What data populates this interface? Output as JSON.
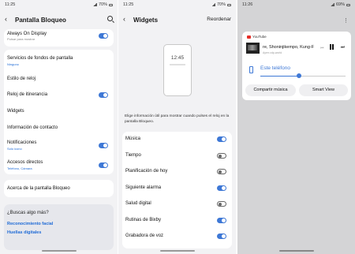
{
  "panel1": {
    "status": {
      "time": "11:25",
      "battery": "70%"
    },
    "title": "Pantalla Bloqueo",
    "items": [
      {
        "label": "Always On Display",
        "sub": "Pulsar para mostrar",
        "toggle": true
      },
      {
        "label": "Servicios de fondos de pantalla",
        "sub": "Ninguno"
      },
      {
        "label": "Estilo de reloj"
      },
      {
        "label": "Reloj de itinerancia",
        "toggle": true
      },
      {
        "label": "Widgets"
      },
      {
        "label": "Información de contacto"
      },
      {
        "label": "Notificaciones",
        "sub": "Solo icono",
        "toggle": true
      },
      {
        "label": "Accesos directos",
        "sub": "Teléfono, Cámara",
        "toggle": true
      },
      {
        "label": "Acerca de la pantalla Bloqueo"
      }
    ],
    "suggest": {
      "title": "¿Buscas algo más?",
      "links": [
        "Reconocimiento facial",
        "Huellas digitales"
      ]
    }
  },
  "panel2": {
    "status": {
      "time": "11:25",
      "battery": "70%"
    },
    "title": "Widgets",
    "action": "Reordenar",
    "preview_clock": "12:45",
    "description": "Elige información útil para mostrar cuando pulses el reloj en la pantalla Bloqueo.",
    "items": [
      {
        "label": "Música",
        "on": true
      },
      {
        "label": "Tiempo",
        "on": false
      },
      {
        "label": "Planificación de hoy",
        "on": false
      },
      {
        "label": "Siguiente alarma",
        "on": true
      },
      {
        "label": "Salud digital",
        "on": false
      },
      {
        "label": "Rutinas de Bixby",
        "on": true
      },
      {
        "label": "Grabadora de voz",
        "on": true
      }
    ]
  },
  "panel3": {
    "status": {
      "time": "11:26",
      "battery": "69%"
    },
    "app": "YouTube",
    "track": "re, Shoninjikempo, Kung-F",
    "artist": "Ayerr.cdp-world",
    "device": "Este teléfono",
    "volume": 0.45,
    "buttons": [
      "Compartir música",
      "Smart View"
    ]
  },
  "colors": {
    "accent": "#3e78d6",
    "link": "#1f6bd6",
    "youtube": "#e52d27"
  }
}
